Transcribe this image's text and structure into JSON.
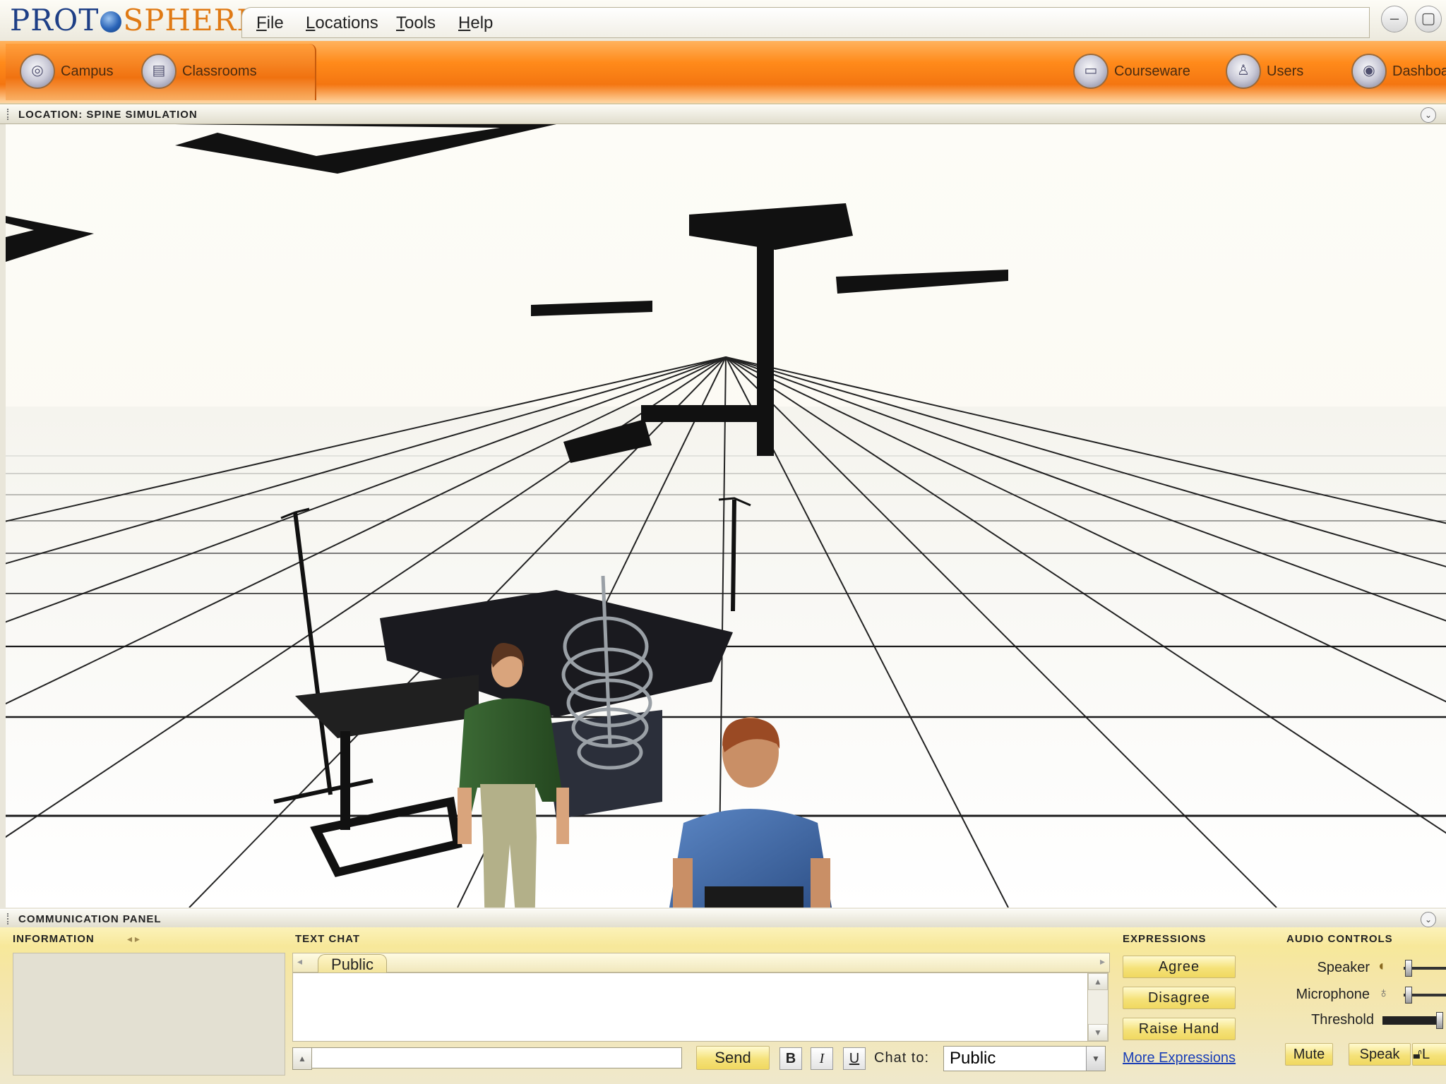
{
  "app": {
    "logo_part1": "PROT",
    "logo_part2": "SPHERE",
    "menu": [
      "File",
      "Locations",
      "Tools",
      "Help"
    ]
  },
  "toolbar": {
    "left_items": [
      "Campus",
      "Classrooms"
    ],
    "right_items": [
      "Courseware",
      "Users",
      "Dashboa"
    ]
  },
  "location_bar": {
    "title": "LOCATION: SPINE SIMULATION"
  },
  "comm_panel": {
    "title": "COMMUNICATION PANEL",
    "information": {
      "title": "INFORMATION"
    },
    "text_chat": {
      "title": "TEXT CHAT",
      "active_tab": "Public",
      "input_value": "",
      "send_label": "Send",
      "bold_label": "B",
      "italic_label": "I",
      "underline_label": "U",
      "chat_to_label": "Chat to:",
      "chat_to_value": "Public"
    },
    "expressions": {
      "title": "EXPRESSIONS",
      "buttons": [
        "Agree",
        "Disagree",
        "Raise Hand"
      ],
      "more_link": "More Expressions"
    },
    "audio_controls": {
      "title": "AUDIO CONTROLS",
      "speaker_label": "Speaker",
      "microphone_label": "Microphone",
      "threshold_label": "Threshold",
      "mute_label": "Mute",
      "speak_label": "Speak",
      "lock_label": "L"
    }
  },
  "colors": {
    "toolbar_orange": "#f47611",
    "panel_yellow": "#f7e89a",
    "logo_blue": "#1e3f86",
    "logo_orange": "#e07a14",
    "link_blue": "#1b3fb6"
  },
  "icons": {
    "campus": "campus-icon",
    "classrooms": "classrooms-icon",
    "courseware": "courseware-icon",
    "users": "users-icon",
    "dashboard": "dashboard-icon",
    "speaker": "speaker-icon",
    "microphone": "microphone-icon",
    "lock": "lock-icon"
  }
}
